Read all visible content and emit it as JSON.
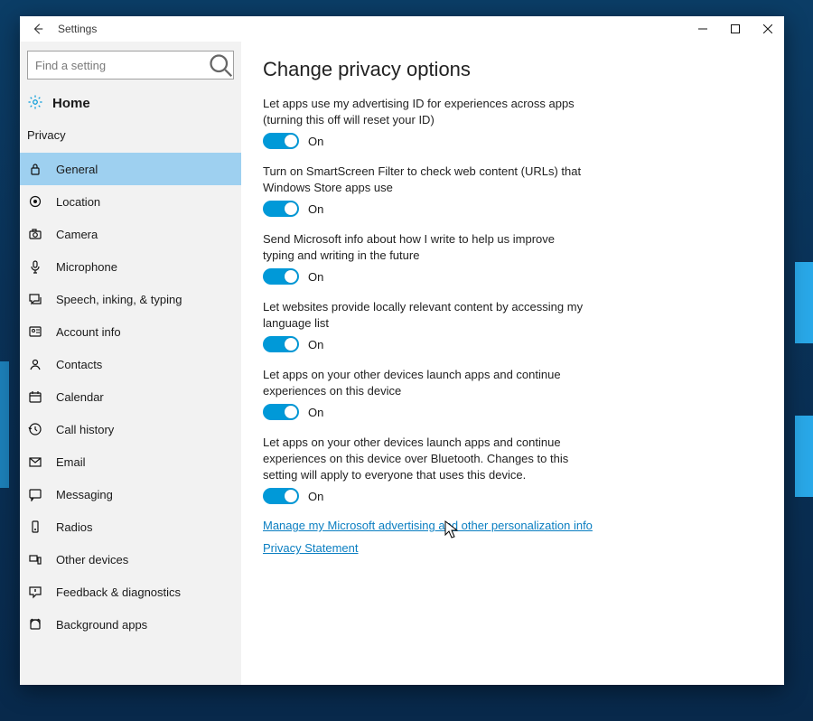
{
  "window": {
    "title": "Settings"
  },
  "search": {
    "placeholder": "Find a setting"
  },
  "home_label": "Home",
  "category_label": "Privacy",
  "nav": [
    {
      "label": "General",
      "active": true,
      "icon": "lock"
    },
    {
      "label": "Location",
      "active": false,
      "icon": "target"
    },
    {
      "label": "Camera",
      "active": false,
      "icon": "camera"
    },
    {
      "label": "Microphone",
      "active": false,
      "icon": "mic"
    },
    {
      "label": "Speech, inking, & typing",
      "active": false,
      "icon": "speech"
    },
    {
      "label": "Account info",
      "active": false,
      "icon": "account"
    },
    {
      "label": "Contacts",
      "active": false,
      "icon": "contacts"
    },
    {
      "label": "Calendar",
      "active": false,
      "icon": "calendar"
    },
    {
      "label": "Call history",
      "active": false,
      "icon": "history"
    },
    {
      "label": "Email",
      "active": false,
      "icon": "email"
    },
    {
      "label": "Messaging",
      "active": false,
      "icon": "messaging"
    },
    {
      "label": "Radios",
      "active": false,
      "icon": "radios"
    },
    {
      "label": "Other devices",
      "active": false,
      "icon": "devices"
    },
    {
      "label": "Feedback & diagnostics",
      "active": false,
      "icon": "feedback"
    },
    {
      "label": "Background apps",
      "active": false,
      "icon": "bgapps"
    }
  ],
  "page_title": "Change privacy options",
  "toggle_state_label": "On",
  "settings": [
    {
      "desc": "Let apps use my advertising ID for experiences across apps (turning this off will reset your ID)",
      "on": true
    },
    {
      "desc": "Turn on SmartScreen Filter to check web content (URLs) that Windows Store apps use",
      "on": true
    },
    {
      "desc": "Send Microsoft info about how I write to help us improve typing and writing in the future",
      "on": true
    },
    {
      "desc": "Let websites provide locally relevant content by accessing my language list",
      "on": true
    },
    {
      "desc": "Let apps on your other devices launch apps and continue experiences on this device",
      "on": true
    },
    {
      "desc": "Let apps on your other devices launch apps and continue experiences on this device over Bluetooth. Changes to this setting will apply to everyone that uses this device.",
      "on": true
    }
  ],
  "links": {
    "manage": "Manage my Microsoft advertising and other personalization info",
    "privacy": "Privacy Statement"
  }
}
